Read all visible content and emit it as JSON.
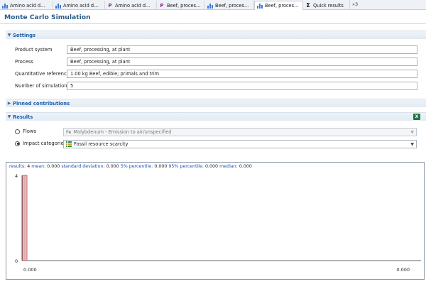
{
  "tabs": [
    {
      "label": "Amino acid d...",
      "icon": "process-bars-icon",
      "active": false
    },
    {
      "label": "Amino acid d...",
      "icon": "process-bars-icon",
      "active": false
    },
    {
      "label": "Amino acid d...",
      "icon": "process-p-icon",
      "active": false
    },
    {
      "label": "Beef, proces...",
      "icon": "process-p-icon",
      "active": false
    },
    {
      "label": "Beef, proces...",
      "icon": "process-bars-icon",
      "active": false
    },
    {
      "label": "Beef, proces...",
      "icon": "process-bars-icon",
      "active": true
    },
    {
      "label": "Quick results",
      "icon": "sigma-icon",
      "active": false
    }
  ],
  "tab_overflow": "»3",
  "editor": {
    "title": "Monte Carlo Simulation"
  },
  "settings": {
    "header": "Settings",
    "product_system_label": "Product system",
    "product_system_value": "Beef, processing, at plant",
    "process_label": "Process",
    "process_value": "Beef, processing, at plant",
    "quant_ref_label": "Quantitative reference",
    "quant_ref_value": "1.00 kg Beef, edible; primals and trim",
    "num_sim_label": "Number of simulations",
    "num_sim_value": "5"
  },
  "pinned": {
    "header": "Pinned contributions"
  },
  "results": {
    "header": "Results",
    "flows_label": "Flows",
    "flows_value": "Molybdenum - Emission to air/unspecified",
    "flows_prefix": "Fe",
    "impact_label": "Impact categories",
    "impact_value": "Fossil resource scarcity",
    "excel_icon": "excel-export-icon"
  },
  "stats": {
    "results_key": "results:",
    "results_val": "4",
    "mean_key": "mean:",
    "mean_val": "0.000",
    "sd_key": "standard deviation:",
    "sd_val": "0.000",
    "p5_key": "5% percentile:",
    "p5_val": "0.000",
    "p95_key": "95% percentile:",
    "p95_val": "0.000",
    "median_key": "median:",
    "median_val": "0.000"
  },
  "chart_data": {
    "type": "bar",
    "x": [
      0.0
    ],
    "values": [
      4
    ],
    "ylim": [
      0,
      4
    ],
    "yticks": [
      "4",
      "0"
    ],
    "xticks": [
      "0.000",
      "0.000"
    ],
    "bar_color": "#f2c8c8",
    "bar_edge": "#b05050"
  }
}
